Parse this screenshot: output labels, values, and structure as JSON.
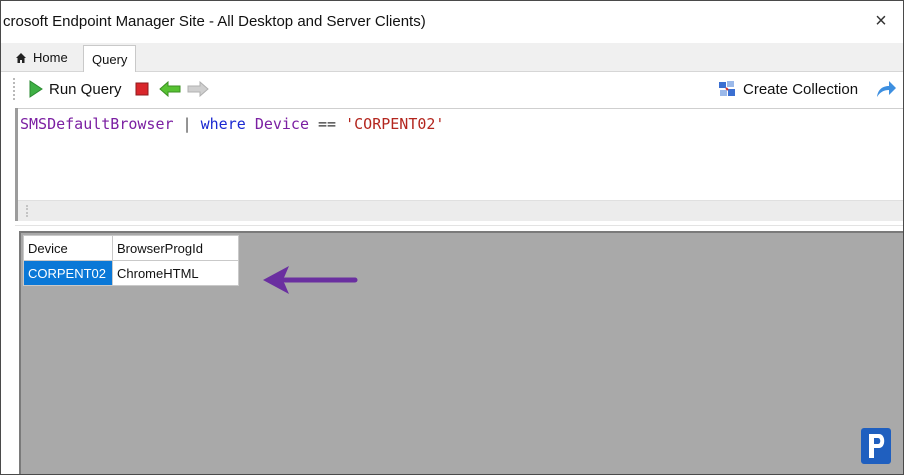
{
  "window": {
    "title": "crosoft Endpoint Manager Site - All Desktop and Server Clients)",
    "close_glyph": "×"
  },
  "tabs": [
    {
      "label": "Home",
      "icon": "home-icon",
      "active": false
    },
    {
      "label": "Query",
      "active": true
    }
  ],
  "toolbar": {
    "run_query_label": "Run Query",
    "run_query_icon": "play-icon",
    "stop_icon": "stop-icon",
    "back_icon": "back-arrow-icon",
    "forward_icon": "forward-arrow-icon",
    "create_collection_label": "Create Collection",
    "create_collection_icon": "collection-icon",
    "share_icon": "share-arrow-icon"
  },
  "editor": {
    "tokens": {
      "table": "SMSDefaultBrowser",
      "pipe": " | ",
      "keyword": "where",
      "space1": " ",
      "field": "Device",
      "op": " == ",
      "string": "'CORPENT02'"
    }
  },
  "results": {
    "columns": [
      "Device",
      "BrowserProgId"
    ],
    "rows": [
      {
        "Device": "CORPENT02",
        "BrowserProgId": "ChromeHTML",
        "selected_column": "Device"
      }
    ]
  },
  "colors": {
    "selection": "#0a78d7",
    "arrow": "#6a2fa0",
    "results_background": "#a9a9a9",
    "keyword": "#1a28d1",
    "identifier": "#7b1fa2",
    "string": "#b3261e"
  }
}
